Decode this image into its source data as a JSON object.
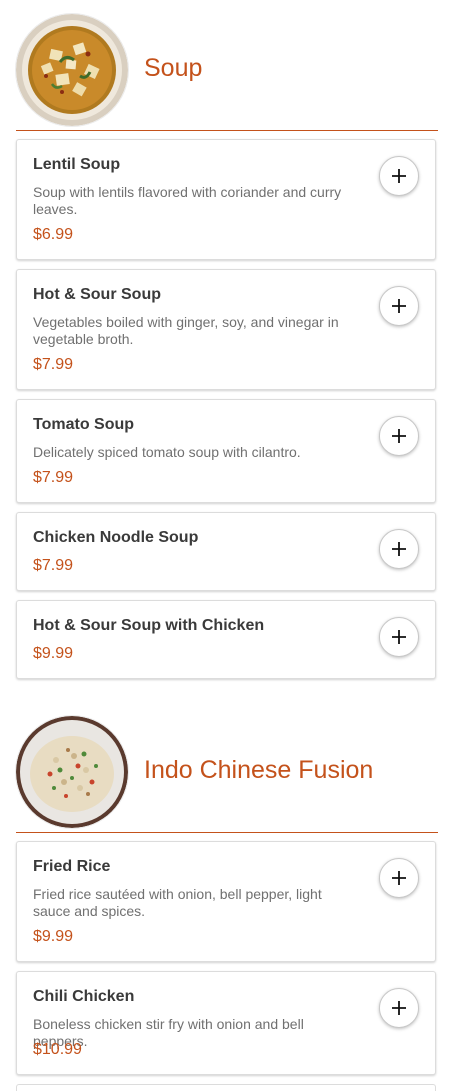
{
  "sections": [
    {
      "title": "Soup",
      "image": "mapo-tofu-soup-bowl-photo",
      "items": [
        {
          "name": "Lentil Soup",
          "description": "Soup with lentils flavored with coriander and curry leaves.",
          "price": "$6.99",
          "action_icon": "plus-icon"
        },
        {
          "name": "Hot & Sour Soup",
          "description": "Vegetables boiled with ginger, soy, and vinegar in vegetable broth.",
          "price": "$7.99",
          "action_icon": "plus-icon"
        },
        {
          "name": "Tomato Soup",
          "description": "Delicately spiced tomato soup with cilantro.",
          "price": "$7.99",
          "action_icon": "plus-icon"
        },
        {
          "name": "Chicken Noodle Soup",
          "description": "",
          "price": "$7.99",
          "action_icon": "plus-icon"
        },
        {
          "name": "Hot & Sour Soup with Chicken",
          "description": "",
          "price": "$9.99",
          "action_icon": "plus-icon"
        }
      ]
    },
    {
      "title": "Indo Chinese Fusion",
      "image": "fried-rice-plate-photo",
      "items": [
        {
          "name": "Fried Rice",
          "description": "Fried rice sautéed with onion, bell pepper, light sauce and spices.",
          "price": "$9.99",
          "action_icon": "plus-icon"
        },
        {
          "name": "Chili Chicken",
          "description": "Boneless chicken stir fry with onion and bell peppers.",
          "price": "$10.99",
          "action_icon": "plus-icon"
        }
      ]
    }
  ],
  "colors": {
    "accent": "#c4521b",
    "item_name": "#3a3a3a",
    "description": "#707070",
    "card_border": "#dcdcdc"
  }
}
